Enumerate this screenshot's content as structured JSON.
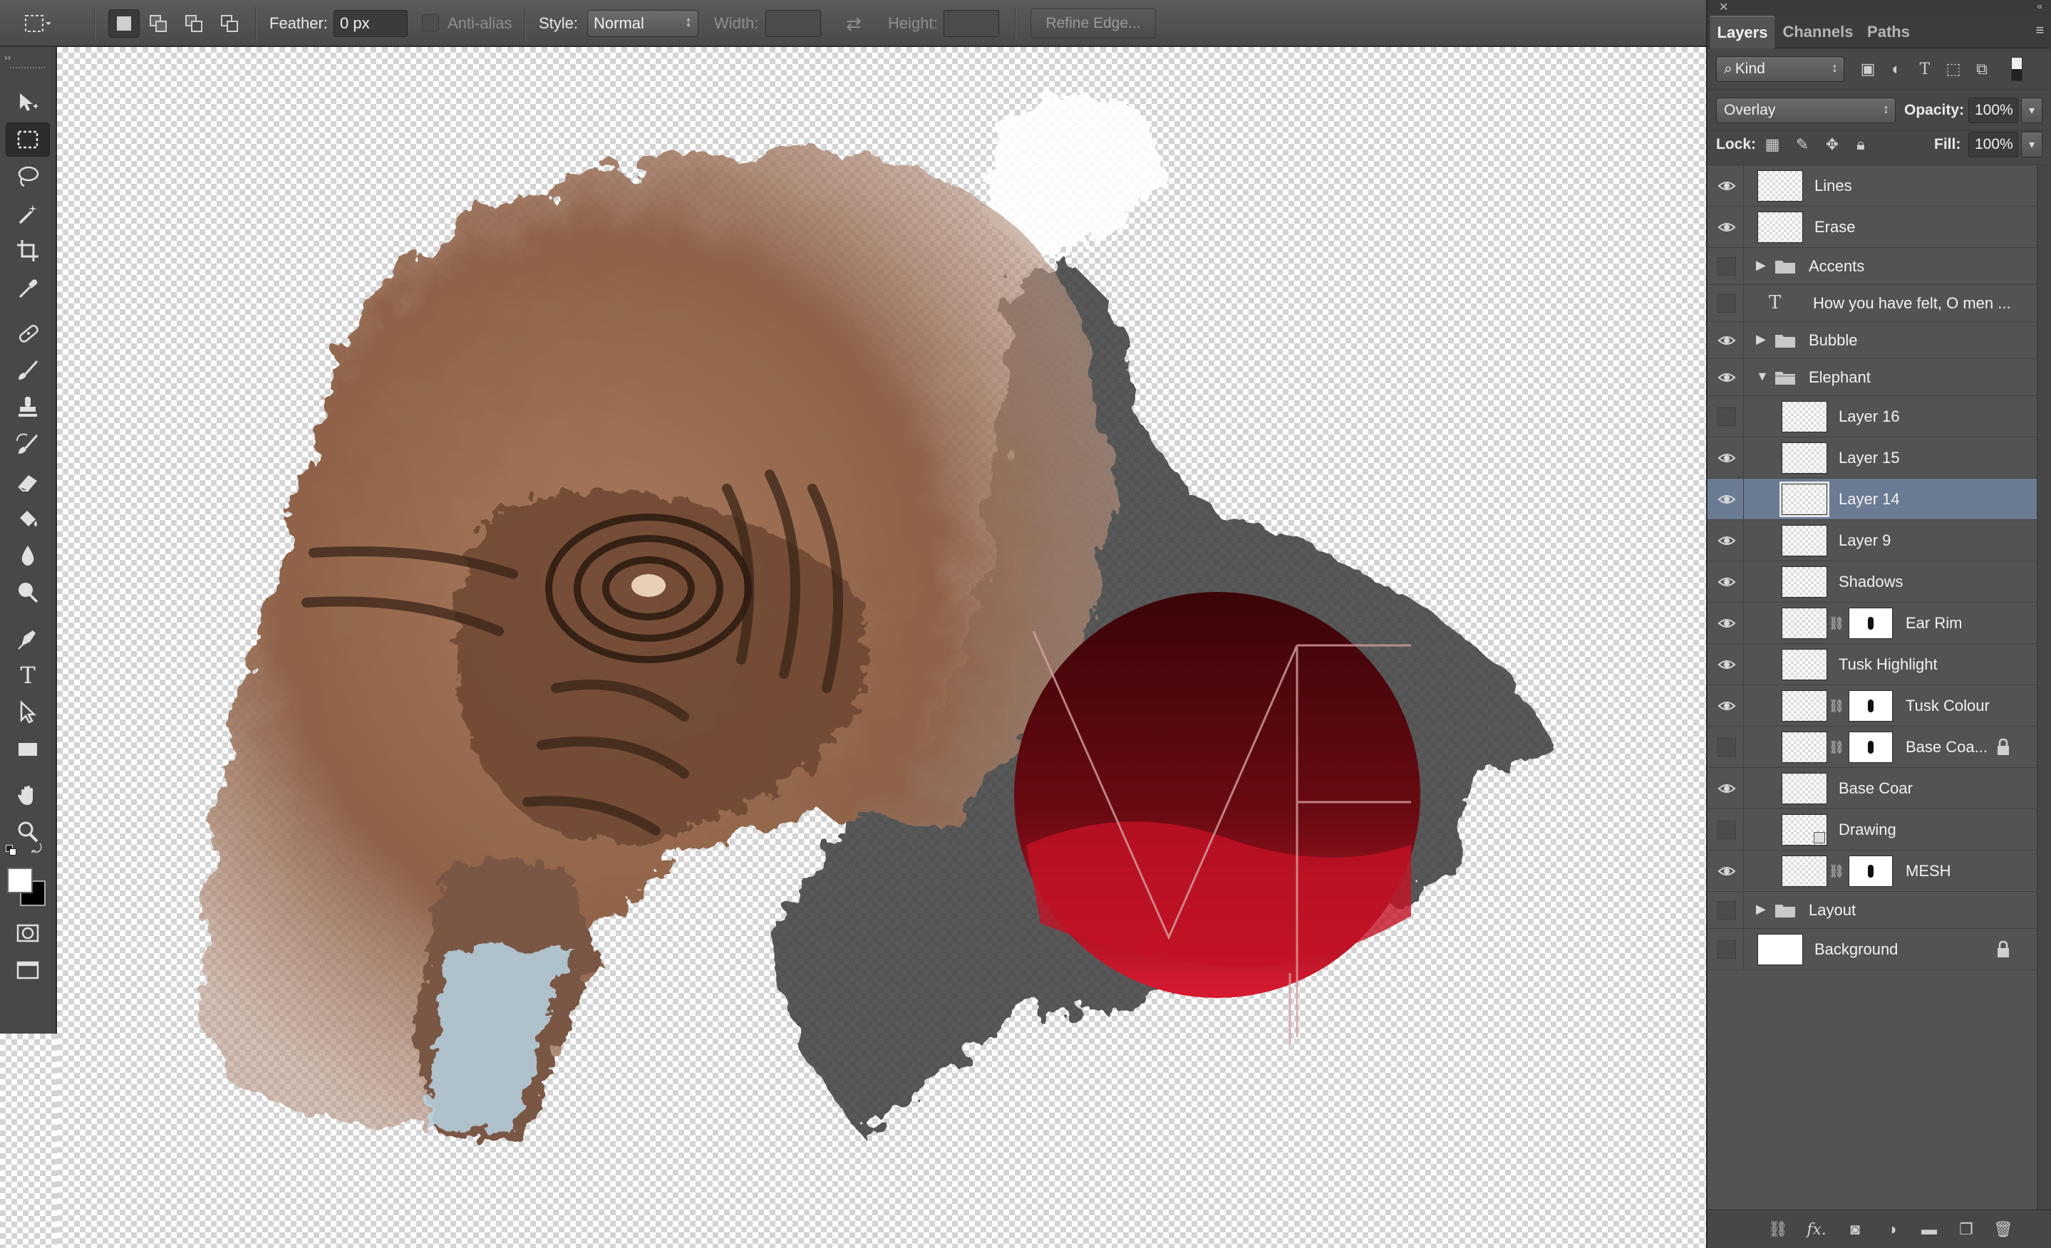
{
  "options_bar": {
    "feather_label": "Feather:",
    "feather_value": "0 px",
    "antialias_label": "Anti-alias",
    "style_label": "Style:",
    "style_value": "Normal",
    "width_label": "Width:",
    "width_value": "",
    "height_label": "Height:",
    "height_value": "",
    "refine_edge_label": "Refine Edge..."
  },
  "tools_panel": {
    "active_tool": "rectangular-marquee-tool",
    "tools": [
      "move-tool",
      "rectangular-marquee-tool",
      "lasso-tool",
      "magic-wand-tool",
      "crop-tool",
      "eyedropper-tool",
      "spot-healing-brush-tool",
      "brush-tool",
      "clone-stamp-tool",
      "history-brush-tool",
      "eraser-tool",
      "paint-bucket-tool",
      "blur-tool",
      "dodge-tool",
      "pen-tool",
      "type-tool",
      "path-selection-tool",
      "rectangle-tool",
      "hand-tool",
      "zoom-tool",
      "quick-mask-mode",
      "screen-mode"
    ],
    "foreground_color": "#ffffff",
    "background_color": "#000000"
  },
  "layers_panel": {
    "tabs": [
      "Layers",
      "Channels",
      "Paths"
    ],
    "active_tab": "Layers",
    "filter_kind": "Kind",
    "blend_mode": "Overlay",
    "opacity_label": "Opacity:",
    "opacity_value": "100%",
    "lock_label": "Lock:",
    "fill_label": "Fill:",
    "fill_value": "100%",
    "selected_layer": "Layer 14",
    "layers": [
      {
        "name": "Lines",
        "visible": true,
        "kind": "pixel"
      },
      {
        "name": "Erase",
        "visible": true,
        "kind": "pixel"
      },
      {
        "name": "Accents",
        "visible": false,
        "kind": "group",
        "expanded": false
      },
      {
        "name": "How you have felt, O men ...",
        "visible": false,
        "kind": "text"
      },
      {
        "name": "Bubble",
        "visible": true,
        "kind": "group",
        "expanded": false
      },
      {
        "name": "Elephant",
        "visible": true,
        "kind": "group",
        "expanded": true
      },
      {
        "name": "Layer 16",
        "visible": false,
        "kind": "pixel",
        "indent": true
      },
      {
        "name": "Layer 15",
        "visible": true,
        "kind": "pixel",
        "indent": true
      },
      {
        "name": "Layer 14",
        "visible": true,
        "kind": "pixel",
        "indent": true
      },
      {
        "name": "Layer 9",
        "visible": true,
        "kind": "pixel",
        "indent": true
      },
      {
        "name": "Shadows",
        "visible": true,
        "kind": "pixel",
        "indent": true
      },
      {
        "name": "Ear Rim",
        "visible": true,
        "kind": "masked",
        "indent": true
      },
      {
        "name": "Tusk Highlight",
        "visible": true,
        "kind": "pixel",
        "indent": true
      },
      {
        "name": "Tusk Colour",
        "visible": true,
        "kind": "masked",
        "indent": true
      },
      {
        "name": "Base Coa...",
        "visible": false,
        "kind": "masked",
        "indent": true,
        "locked": true
      },
      {
        "name": "Base Coar",
        "visible": true,
        "kind": "pixel",
        "indent": true
      },
      {
        "name": "Drawing",
        "visible": false,
        "kind": "smart",
        "indent": true
      },
      {
        "name": "MESH",
        "visible": true,
        "kind": "masked",
        "indent": true
      },
      {
        "name": "Layout",
        "visible": false,
        "kind": "group",
        "expanded": false
      },
      {
        "name": "Background",
        "visible": false,
        "kind": "background",
        "locked": true
      }
    ]
  },
  "canvas": {
    "artwork": "elephant head painting with red circle",
    "accent_red": "#c8102e",
    "elephant_brown": "#9a6a4e"
  }
}
